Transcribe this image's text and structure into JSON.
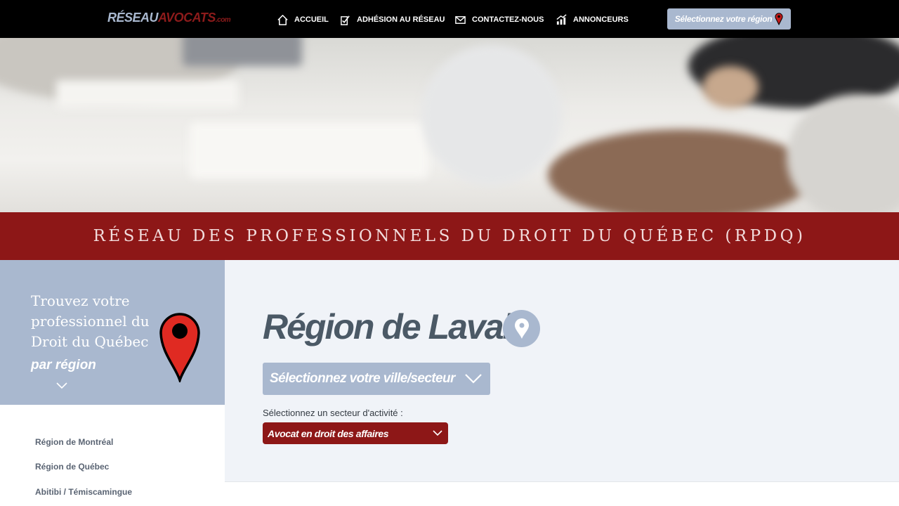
{
  "header": {
    "logo": {
      "part1": "RÉSEAU",
      "part2": "AVOCATS",
      "part3": ".com"
    },
    "nav": [
      {
        "label": "ACCUEIL",
        "icon": "home-icon"
      },
      {
        "label": "ADHÉSION AU RÉSEAU",
        "icon": "checklist-icon"
      },
      {
        "label": "CONTACTEZ-NOUS",
        "icon": "envelope-icon"
      },
      {
        "label": "ANNONCEURS",
        "icon": "growth-chart-icon"
      }
    ],
    "region_button": {
      "label": "Sélectionnez votre région",
      "icon": "map-pin-icon"
    }
  },
  "banner": {
    "title": "RÉSEAU DES PROFESSIONNELS DU DROIT DU QUÉBEC (RPDQ)"
  },
  "sidebar": {
    "title": "Trouvez votre professionnel du Droit du Québec",
    "subtitle": "par région",
    "regions": [
      "Région de Montréal",
      "Région de Québec",
      "Abitibi / Témiscamingue"
    ]
  },
  "main": {
    "title": "Région de Laval",
    "city_select": {
      "label": "Sélectionnez votre ville/secteur"
    },
    "sector": {
      "label": "Sélectionnez un secteur d'activité :",
      "selected": "Avocat en droit des affaires"
    }
  },
  "colors": {
    "accent_red": "#8d1717",
    "accent_blue": "#a9b8cf",
    "topbar": "#000000"
  }
}
